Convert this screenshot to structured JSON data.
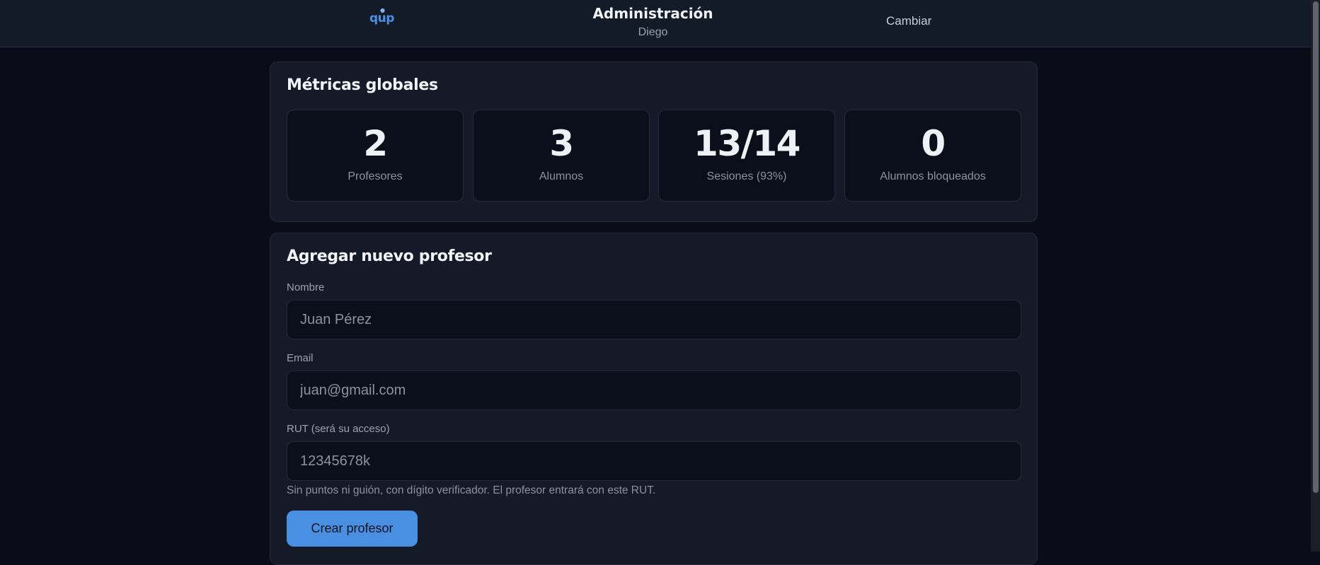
{
  "header": {
    "logo_text": "qup",
    "title": "Administración",
    "subtitle": "Diego",
    "switch_label": "Cambiar"
  },
  "metrics": {
    "title": "Métricas globales",
    "items": [
      {
        "value": "2",
        "label": "Profesores"
      },
      {
        "value": "3",
        "label": "Alumnos"
      },
      {
        "value": "13/14",
        "label": "Sesiones (93%)"
      },
      {
        "value": "0",
        "label": "Alumnos bloqueados"
      }
    ]
  },
  "form": {
    "title": "Agregar nuevo profesor",
    "name_label": "Nombre",
    "name_placeholder": "Juan Pérez",
    "email_label": "Email",
    "email_placeholder": "juan@gmail.com",
    "rut_label": "RUT (será su acceso)",
    "rut_placeholder": "12345678k",
    "rut_hint": "Sin puntos ni guión, con dígito verificador. El profesor entrará con este RUT.",
    "submit_label": "Crear profesor"
  },
  "colors": {
    "accent": "#4a90e2",
    "background": "#0a0d17",
    "card": "#141a27"
  }
}
